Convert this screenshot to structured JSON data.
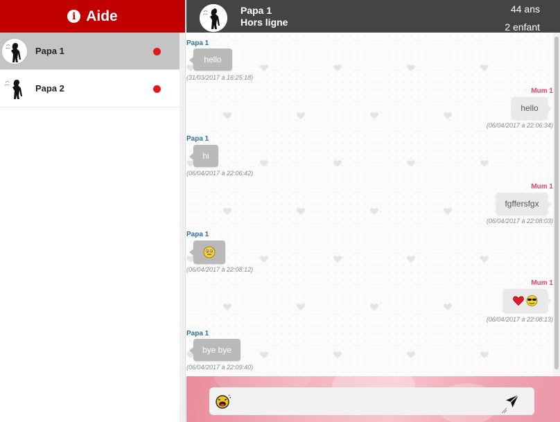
{
  "sidebar": {
    "help_label": "Aide",
    "contacts": [
      {
        "name": "Papa 1",
        "active": true,
        "status_color": "#e0191e"
      },
      {
        "name": "Papa 2",
        "active": false,
        "status_color": "#e0191e"
      }
    ]
  },
  "header": {
    "name": "Papa 1",
    "status": "Hors ligne",
    "age": "44 ans",
    "children": "2 enfant"
  },
  "messages": [
    {
      "sender": "Papa 1",
      "direction": "in",
      "text": "hello",
      "time": "(31/03/2017 à 16:25:18)"
    },
    {
      "sender": "Mum 1",
      "direction": "out",
      "text": "hello",
      "time": "(06/04/2017 à 22:06:34)"
    },
    {
      "sender": "Papa 1",
      "direction": "in",
      "text": "hi",
      "time": "(06/04/2017 à 22:06:42)"
    },
    {
      "sender": "Mum 1",
      "direction": "out",
      "text": "fgffersfgx",
      "time": "(06/04/2017 à 22:08:03)"
    },
    {
      "sender": "Papa 1",
      "direction": "in",
      "emoji": "confused-face-icon",
      "time": "(06/04/2017 à 22:08:12)"
    },
    {
      "sender": "Mum 1",
      "direction": "out",
      "emoji": "heart-and-sunglasses-face-icons",
      "time": "(06/04/2017 à 22:08:13)"
    },
    {
      "sender": "Papa 1",
      "direction": "in",
      "text": "bye bye",
      "time": "(06/04/2017 à 22:09:40)"
    }
  ],
  "composer": {
    "value": "",
    "placeholder": ""
  },
  "colors": {
    "help_bar": "#c10000",
    "header": "#444444",
    "incoming_bubble": "#b9b9b9",
    "outgoing_bubble": "#e9e9e9",
    "incoming_sender": "#2d6f96",
    "outgoing_sender": "#e8406a"
  },
  "icons": [
    "info-icon",
    "avatar-silhouette-icon",
    "heart-pattern-icon",
    "emoji-picker-icon",
    "send-icon"
  ]
}
